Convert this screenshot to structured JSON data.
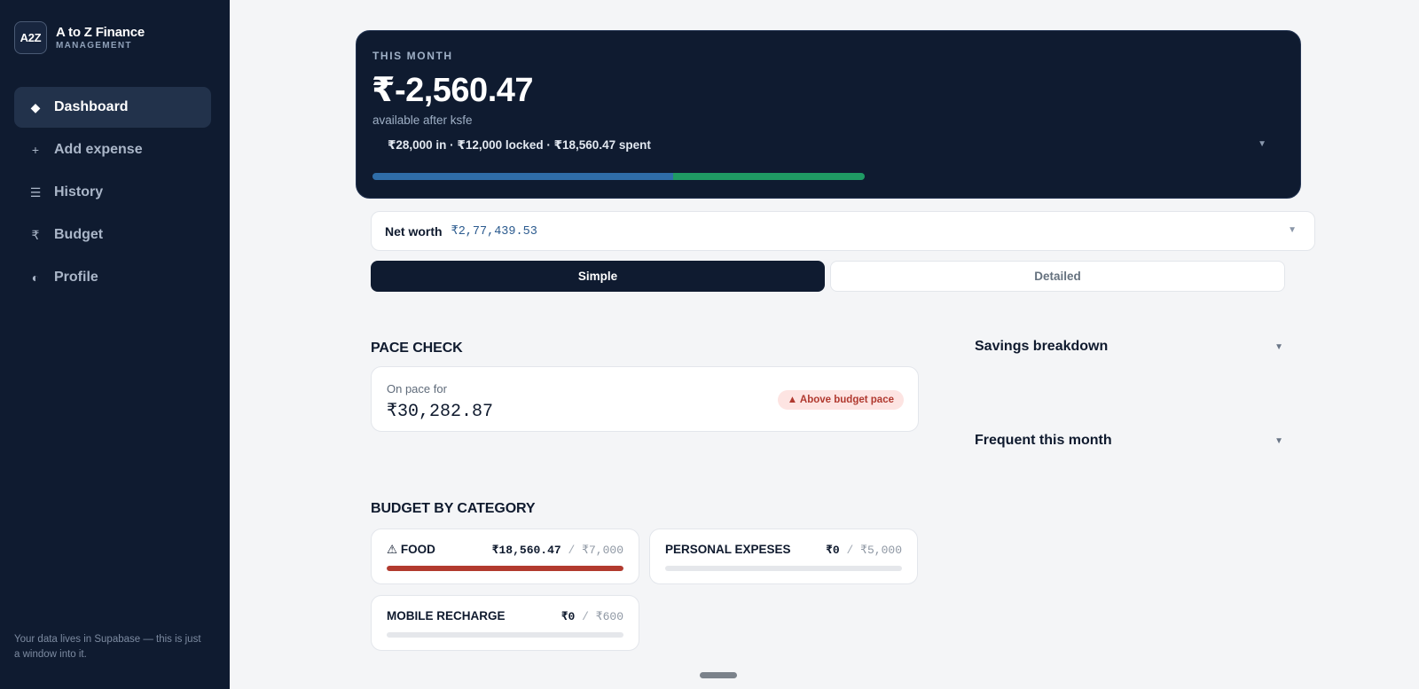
{
  "sidebar": {
    "logo": "A2Z",
    "brand_title": "A to Z Finance",
    "brand_sub": "MANAGEMENT",
    "items": [
      {
        "label": "Dashboard",
        "icon": "diamond-icon",
        "glyph": "◆"
      },
      {
        "label": "Add expense",
        "icon": "plus-icon",
        "glyph": "+"
      },
      {
        "label": "History",
        "icon": "list-icon",
        "glyph": "☰"
      },
      {
        "label": "Budget",
        "icon": "rupee-icon",
        "glyph": "₹"
      },
      {
        "label": "Profile",
        "icon": "half-circle-icon",
        "glyph": "◐"
      }
    ],
    "footer": "Your data lives in Supabase — this is just a window into it."
  },
  "hero": {
    "kicker": "THIS MONTH",
    "amount": "₹-2,560.47",
    "note": "available after ksfe",
    "flow": "₹28,000 in · ₹12,000 locked · ₹18,560.47 spent",
    "bar_locked_pct": 61,
    "bar_spent_pct": 39,
    "colors": {
      "locked": "#2f6da8",
      "spent": "#1f9a63"
    }
  },
  "networth": {
    "label": "Net worth",
    "value": "₹2,77,439.53"
  },
  "view_toggle": {
    "simple": "Simple",
    "detailed": "Detailed",
    "selected": "Simple"
  },
  "pace": {
    "heading": "PACE CHECK",
    "label": "On pace for",
    "value": "₹30,282.87",
    "badge": "▲ Above budget pace"
  },
  "side_panels": {
    "savings": "Savings breakdown",
    "frequent": "Frequent this month"
  },
  "budget": {
    "heading": "BUDGET BY CATEGORY",
    "categories": [
      {
        "name": "⚠ FOOD",
        "spent": "₹18,560.47",
        "limit": "₹7,000",
        "fill_pct": 100
      },
      {
        "name": "PERSONAL EXPESES",
        "spent": "₹0",
        "limit": "₹5,000",
        "fill_pct": 0
      },
      {
        "name": "MOBILE RECHARGE",
        "spent": "₹0",
        "limit": "₹600",
        "fill_pct": 0
      }
    ],
    "over_color": "#b23a2e"
  },
  "separator": "/"
}
